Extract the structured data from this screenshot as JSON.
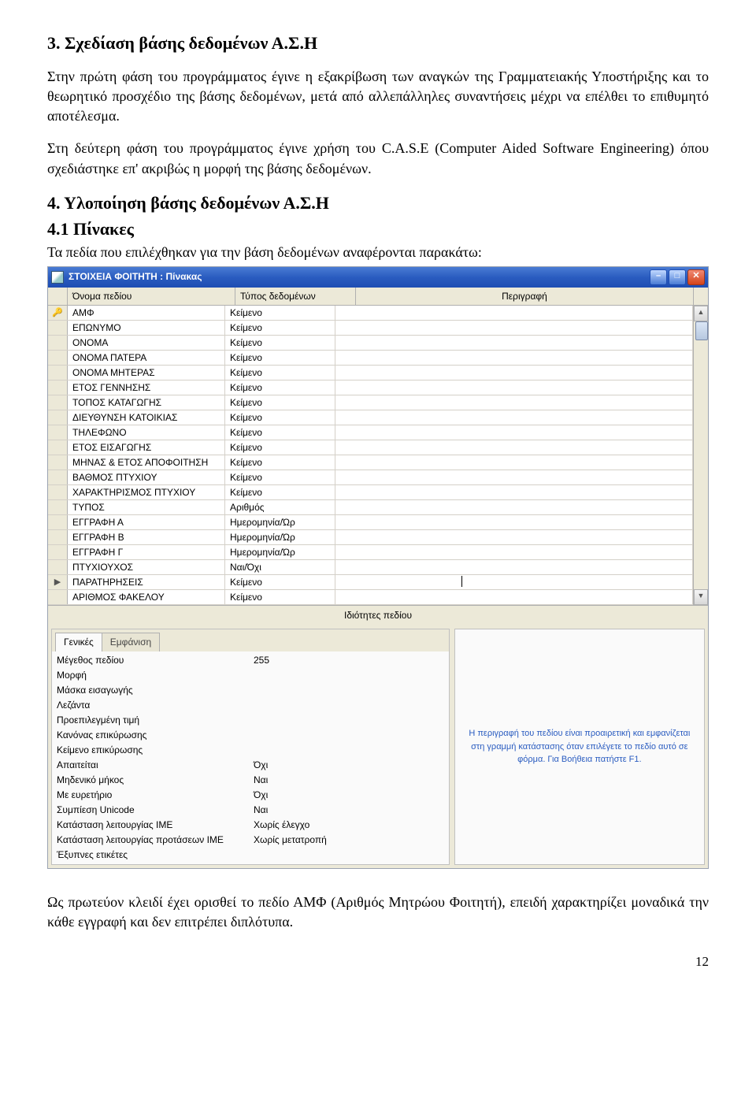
{
  "doc": {
    "heading1": "3. Σχεδίαση βάσης δεδομένων Α.Σ.Η",
    "p1": "Στην πρώτη φάση του προγράμματος  έγινε η εξακρίβωση των αναγκών της Γραμματειακής Υποστήριξης και το θεωρητικό προσχέδιο της βάσης δεδομένων, μετά από αλλεπάλληλες συναντήσεις μέχρι να επέλθει το επιθυμητό αποτέλεσμα.",
    "p2": "Στη δεύτερη φάση του προγράμματος  έγινε χρήση του C.A.S.E (Computer Aided Software Engineering) όπου σχεδιάστηκε επ' ακριβώς η μορφή της βάσης δεδομένων.",
    "heading2": "4. Υλοποίηση βάσης δεδομένων Α.Σ.Η",
    "heading3": "4.1 Πίνακες",
    "p3": "Τα πεδία που επιλέχθηκαν για την βάση δεδομένων αναφέρονται παρακάτω:",
    "p4": "Ως πρωτεύον κλειδί έχει ορισθεί το πεδίο ΑΜΦ (Αριθμός Μητρώου Φοιτητή), επειδή χαρακτηρίζει μοναδικά την κάθε εγγραφή και δεν επιτρέπει διπλότυπα.",
    "pageNum": "12"
  },
  "window": {
    "title": "ΣΤΟΙΧΕΙΑ ΦΟΙΤΗΤΗ : Πίνακας",
    "cols": {
      "name": "Όνομα πεδίου",
      "type": "Τύπος δεδομένων",
      "desc": "Περιγραφή"
    },
    "fields": [
      {
        "sel": "🔑",
        "name": "ΑΜΦ",
        "type": "Κείμενο"
      },
      {
        "sel": "",
        "name": "ΕΠΩΝΥΜΟ",
        "type": "Κείμενο"
      },
      {
        "sel": "",
        "name": "ΟΝΟΜΑ",
        "type": "Κείμενο"
      },
      {
        "sel": "",
        "name": "ΟΝΟΜΑ ΠΑΤΕΡΑ",
        "type": "Κείμενο"
      },
      {
        "sel": "",
        "name": "ΟΝΟΜΑ ΜΗΤΕΡΑΣ",
        "type": "Κείμενο"
      },
      {
        "sel": "",
        "name": "ΕΤΟΣ ΓΕΝΝΗΣΗΣ",
        "type": "Κείμενο"
      },
      {
        "sel": "",
        "name": "ΤΟΠΟΣ ΚΑΤΑΓΩΓΗΣ",
        "type": "Κείμενο"
      },
      {
        "sel": "",
        "name": "ΔΙΕΥΘΥΝΣΗ ΚΑΤΟΙΚΙΑΣ",
        "type": "Κείμενο"
      },
      {
        "sel": "",
        "name": "ΤΗΛΕΦΩΝΟ",
        "type": "Κείμενο"
      },
      {
        "sel": "",
        "name": "ΕΤΟΣ ΕΙΣΑΓΩΓΗΣ",
        "type": "Κείμενο"
      },
      {
        "sel": "",
        "name": "ΜΗΝΑΣ & ΕΤΟΣ ΑΠΟΦΟΙΤΗΣΗ",
        "type": "Κείμενο"
      },
      {
        "sel": "",
        "name": "ΒΑΘΜΟΣ ΠΤΥΧΙΟΥ",
        "type": "Κείμενο"
      },
      {
        "sel": "",
        "name": "ΧΑΡΑΚΤΗΡΙΣΜΟΣ ΠΤΥΧΙΟΥ",
        "type": "Κείμενο"
      },
      {
        "sel": "",
        "name": "ΤΥΠΟΣ",
        "type": "Αριθμός"
      },
      {
        "sel": "",
        "name": "ΕΓΓΡΑΦΗ Α",
        "type": "Ημερομηνία/Ώρ"
      },
      {
        "sel": "",
        "name": "ΕΓΓΡΑΦΗ Β",
        "type": "Ημερομηνία/Ώρ"
      },
      {
        "sel": "",
        "name": "ΕΓΓΡΑΦΗ Γ",
        "type": "Ημερομηνία/Ώρ"
      },
      {
        "sel": "",
        "name": "ΠΤΥΧΙΟΥΧΟΣ",
        "type": "Ναι/Όχι"
      },
      {
        "sel": "▶",
        "name": "ΠΑΡΑΤΗΡΗΣΕΙΣ",
        "type": "Κείμενο",
        "active": true
      },
      {
        "sel": "",
        "name": "ΑΡΙΘΜΟΣ ΦΑΚΕΛΟΥ",
        "type": "Κείμενο"
      }
    ],
    "propsTitle": "Ιδιότητες πεδίου",
    "tabs": {
      "general": "Γενικές",
      "display": "Εμφάνιση"
    },
    "props": [
      {
        "label": "Μέγεθος πεδίου",
        "val": "255"
      },
      {
        "label": "Μορφή",
        "val": ""
      },
      {
        "label": "Μάσκα εισαγωγής",
        "val": ""
      },
      {
        "label": "Λεζάντα",
        "val": ""
      },
      {
        "label": "Προεπιλεγμένη τιμή",
        "val": ""
      },
      {
        "label": "Κανόνας επικύρωσης",
        "val": ""
      },
      {
        "label": "Κείμενο επικύρωσης",
        "val": ""
      },
      {
        "label": "Απαιτείται",
        "val": "Όχι"
      },
      {
        "label": "Μηδενικό μήκος",
        "val": "Ναι"
      },
      {
        "label": "Με ευρετήριο",
        "val": "Όχι"
      },
      {
        "label": "Συμπίεση Unicode",
        "val": "Ναι"
      },
      {
        "label": "Κατάσταση λειτουργίας IME",
        "val": "Χωρίς έλεγχο"
      },
      {
        "label": "Κατάσταση λειτουργίας προτάσεων IME",
        "val": "Χωρίς μετατροπή"
      },
      {
        "label": "Έξυπνες ετικέτες",
        "val": ""
      }
    ],
    "helpText": "Η περιγραφή του πεδίου είναι προαιρετική και εμφανίζεται στη γραμμή κατάστασης όταν επιλέγετε το πεδίο αυτό σε φόρμα. Για Βοήθεια πατήστε F1."
  }
}
